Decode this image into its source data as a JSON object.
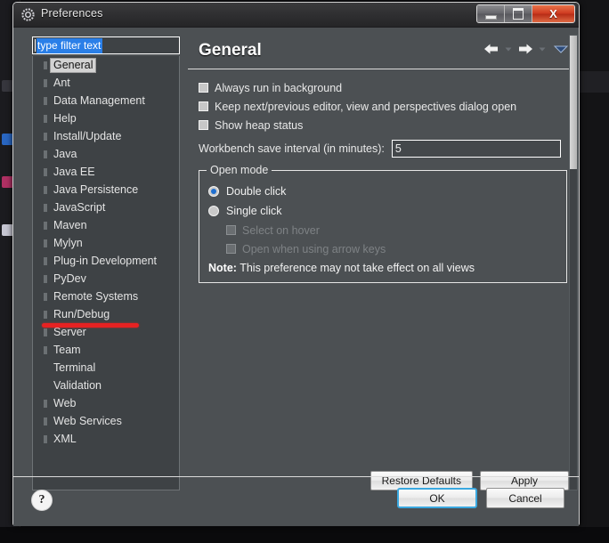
{
  "window": {
    "title": "Preferences",
    "icon": "gear-icon",
    "controls": {
      "minimize": "–",
      "maximize": "□",
      "close": "X"
    }
  },
  "sidebar": {
    "filter": {
      "value": "type filter text",
      "placeholder": "type filter text",
      "selected": true
    },
    "items": [
      {
        "label": "General",
        "expandable": true,
        "selected": true
      },
      {
        "label": "Ant",
        "expandable": true,
        "selected": false
      },
      {
        "label": "Data Management",
        "expandable": true,
        "selected": false
      },
      {
        "label": "Help",
        "expandable": true,
        "selected": false
      },
      {
        "label": "Install/Update",
        "expandable": true,
        "selected": false
      },
      {
        "label": "Java",
        "expandable": true,
        "selected": false
      },
      {
        "label": "Java EE",
        "expandable": true,
        "selected": false
      },
      {
        "label": "Java Persistence",
        "expandable": true,
        "selected": false
      },
      {
        "label": "JavaScript",
        "expandable": true,
        "selected": false
      },
      {
        "label": "Maven",
        "expandable": true,
        "selected": false
      },
      {
        "label": "Mylyn",
        "expandable": true,
        "selected": false
      },
      {
        "label": "Plug-in Development",
        "expandable": true,
        "selected": false
      },
      {
        "label": "PyDev",
        "expandable": true,
        "selected": false
      },
      {
        "label": "Remote Systems",
        "expandable": true,
        "selected": false
      },
      {
        "label": "Run/Debug",
        "expandable": true,
        "selected": false
      },
      {
        "label": "Server",
        "expandable": true,
        "selected": false
      },
      {
        "label": "Team",
        "expandable": true,
        "selected": false
      },
      {
        "label": "Terminal",
        "expandable": false,
        "selected": false
      },
      {
        "label": "Validation",
        "expandable": false,
        "selected": false
      },
      {
        "label": "Web",
        "expandable": true,
        "selected": false
      },
      {
        "label": "Web Services",
        "expandable": true,
        "selected": false
      },
      {
        "label": "XML",
        "expandable": true,
        "selected": false
      }
    ],
    "annotation": {
      "type": "red-underline",
      "target": "PyDev",
      "color": "#e62222"
    }
  },
  "page": {
    "title": "General",
    "nav": {
      "back": "back-arrow-icon",
      "back_menu": "chevron-down-icon",
      "forward": "forward-arrow-icon",
      "forward_menu": "chevron-down-icon",
      "menu": "view-menu-icon"
    },
    "checkboxes": [
      {
        "label": "Always run in background",
        "checked": false,
        "enabled": true
      },
      {
        "label": "Keep next/previous editor, view and perspectives dialog open",
        "checked": false,
        "enabled": true
      },
      {
        "label": "Show heap status",
        "checked": false,
        "enabled": true
      }
    ],
    "save_interval": {
      "label": "Workbench save interval (in minutes):",
      "value": "5"
    },
    "open_mode": {
      "legend": "Open mode",
      "radios": [
        {
          "label": "Double click",
          "selected": true
        },
        {
          "label": "Single click",
          "selected": false
        }
      ],
      "sub_checkboxes": [
        {
          "label": "Select on hover",
          "checked": false,
          "enabled": false
        },
        {
          "label": "Open when using arrow keys",
          "checked": false,
          "enabled": false
        }
      ],
      "note_prefix": "Note:",
      "note_text": "This preference may not take effect on all views"
    },
    "buttons": {
      "restore_defaults": "Restore Defaults",
      "apply": "Apply"
    }
  },
  "footer": {
    "help": "?",
    "ok": "OK",
    "cancel": "Cancel"
  },
  "colors": {
    "accent": "#2a7fe8",
    "focus_ring": "#3aa8e0",
    "annotation": "#e62222",
    "close_button": "#cf3b21"
  }
}
